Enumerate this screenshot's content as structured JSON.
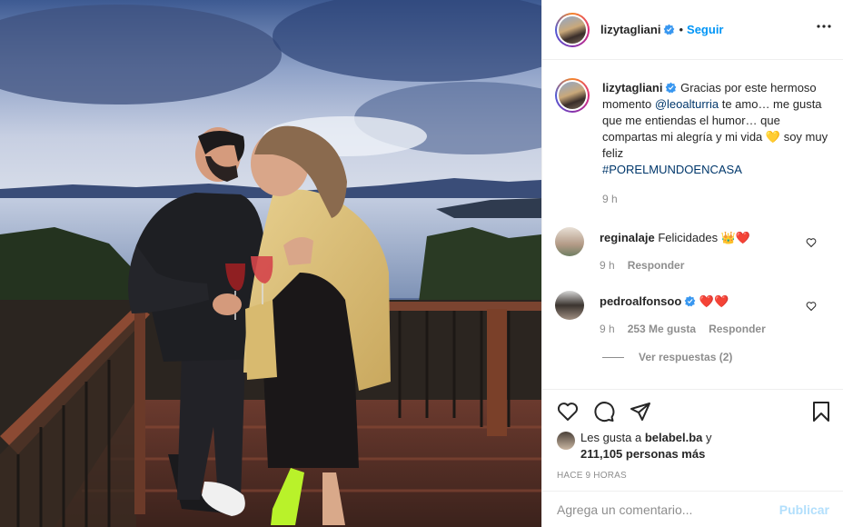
{
  "post": {
    "author": "lizytagliani",
    "follow_label": "Seguir",
    "dot": "•",
    "caption": {
      "prefix": "Gracias por este hermoso momento ",
      "mention": "@leoalturria",
      "middle": " te amo… me gusta que me entiendas el humor… que compartas mi alegría y mi vida ",
      "emoji": "💛",
      "suffix": " soy muy feliz",
      "hashtag": "#PORELMUNDOENCASA",
      "time": "9 h"
    },
    "comments": [
      {
        "user": "reginalaje",
        "text": "Felicidades ",
        "emoji": "👑❤️",
        "time": "9 h",
        "reply": "Responder"
      },
      {
        "user": "pedroalfonsoo",
        "text": "",
        "emoji": "❤️❤️",
        "time": "9 h",
        "likes": "253 Me gusta",
        "reply": "Responder"
      }
    ],
    "view_replies": "Ver respuestas (2)",
    "likes": {
      "prefix": "Les gusta a ",
      "user": "belabel.ba",
      "conj": " y",
      "count": "211,105 personas más"
    },
    "posted_ago": "HACE 9 HORAS",
    "comment_placeholder": "Agrega un comentario...",
    "publish_label": "Publicar"
  },
  "icons": [
    "verified-badge-icon",
    "more-options-icon",
    "heart-icon",
    "comment-icon",
    "share-icon",
    "bookmark-icon"
  ],
  "colors": {
    "link": "#0095f6",
    "mention": "#00376b",
    "muted": "#8e8e8e",
    "publish_disabled": "#b2dffc",
    "like_heart": "#ed4956"
  }
}
